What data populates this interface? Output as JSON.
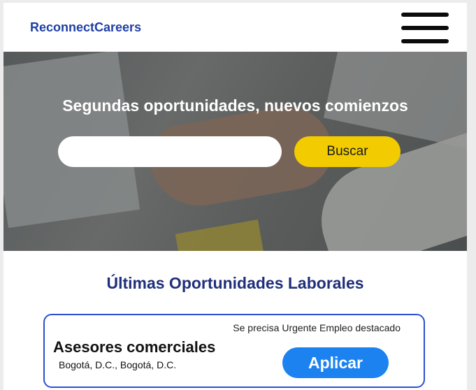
{
  "header": {
    "brand": "ReconnectCareers",
    "menu_icon": "hamburger-menu-icon"
  },
  "hero": {
    "title": "Segundas oportunidades, nuevos comienzos",
    "search_value": "",
    "search_button": "Buscar"
  },
  "section": {
    "title": "Últimas Oportunidades Laborales"
  },
  "jobs": [
    {
      "meta": "Se precisa Urgente Empleo destacado",
      "title": "Asesores comerciales",
      "location": "Bogotá, D.C., Bogotá, D.C.",
      "apply_label": "Aplicar"
    }
  ],
  "colors": {
    "brand": "#1f3fa6",
    "search_button": "#f2cc00",
    "apply_button": "#1b82f0",
    "card_border": "#2c4fd0",
    "section_title": "#1f2f7a"
  }
}
